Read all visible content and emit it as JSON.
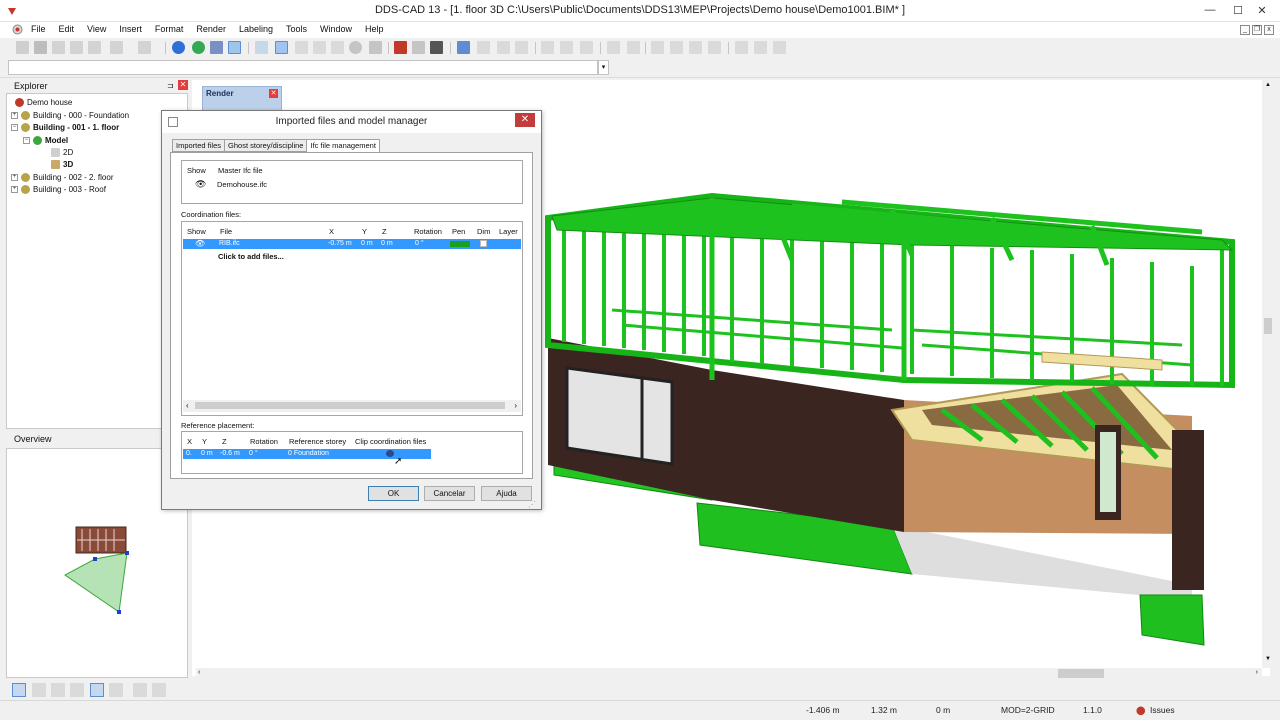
{
  "window": {
    "title": "DDS-CAD 13 - [1. floor  3D  C:\\Users\\Public\\Documents\\DDS13\\MEP\\Projects\\Demo house\\Demo1001.BIM* ]",
    "minimize": "—",
    "maximize": "☐",
    "close": "✕"
  },
  "menu": [
    "File",
    "Edit",
    "View",
    "Insert",
    "Format",
    "Render",
    "Labeling",
    "Tools",
    "Window",
    "Help"
  ],
  "explorer": {
    "title": "Explorer",
    "items": [
      {
        "label": "Demo house",
        "bold": false
      },
      {
        "label": "Building - 000 - Foundation",
        "bold": false
      },
      {
        "label": "Building - 001 - 1. floor",
        "bold": true
      },
      {
        "label": "Model",
        "bold": true
      },
      {
        "label": "2D",
        "bold": false
      },
      {
        "label": "3D",
        "bold": true
      },
      {
        "label": "Building - 002 - 2. floor",
        "bold": false
      },
      {
        "label": "Building - 003 - Roof",
        "bold": false
      }
    ]
  },
  "overview": {
    "title": "Overview"
  },
  "render_toolbar": {
    "title": "Render"
  },
  "dialog": {
    "title": "Imported files and model manager",
    "tabs": [
      "Imported files",
      "Ghost storey/discipline",
      "Ifc file management"
    ],
    "active_tab": "Ifc file management",
    "master": {
      "headers": [
        "Show",
        "Master Ifc file"
      ],
      "file": "Demohouse.ifc"
    },
    "coordination": {
      "label": "Coordination files:",
      "headers": [
        "Show",
        "File",
        "X",
        "Y",
        "Z",
        "Rotation",
        "Pen",
        "Dim",
        "Layer"
      ],
      "row": {
        "file": "RIB.ifc",
        "x": "-0.75 m",
        "y": "0 m",
        "z": "0 m",
        "rotation": "0 °"
      },
      "add_files": "Click to add files..."
    },
    "reference": {
      "label": "Reference placement:",
      "headers": [
        "X",
        "Y",
        "Z",
        "Rotation",
        "Reference storey",
        "Clip coordination files"
      ],
      "row": {
        "x": "0.",
        "y": "0 m",
        "z": "-0.6 m",
        "rotation": "0 °",
        "storey": "0 Foundation"
      }
    },
    "buttons": {
      "ok": "OK",
      "cancel": "Cancelar",
      "help": "Ajuda"
    }
  },
  "status": {
    "x": "-1.406 m",
    "y": "1.32 m",
    "z": "0 m",
    "mode": "MOD=2-GRID",
    "version": "1.1.0",
    "issues": "Issues"
  },
  "colors": {
    "frame_green": "#1ec21e",
    "dark_wall": "#3a2520",
    "selection_blue": "#3399ff",
    "close_red": "#e43c3c"
  }
}
